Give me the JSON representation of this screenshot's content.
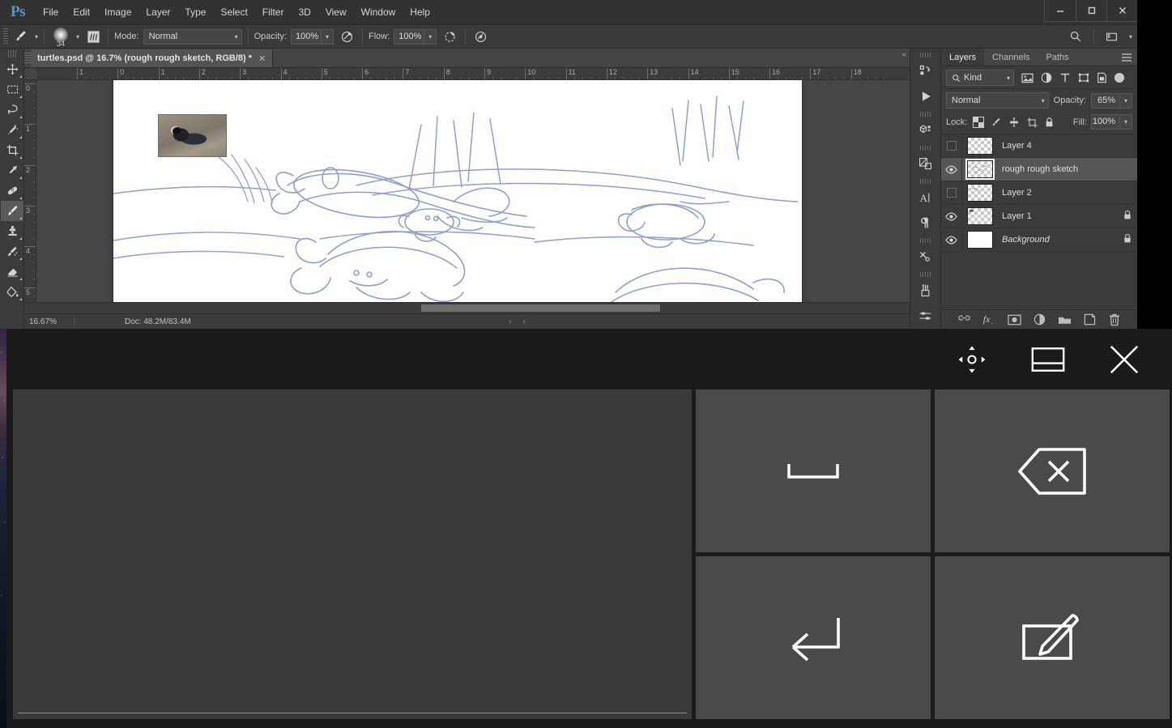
{
  "app": {
    "logo": "Ps",
    "menu": [
      "File",
      "Edit",
      "Image",
      "Layer",
      "Type",
      "Select",
      "Filter",
      "3D",
      "View",
      "Window",
      "Help"
    ],
    "window_controls": {
      "minimize": "—",
      "maximize": "□",
      "close": "✕"
    }
  },
  "options_bar": {
    "brush_size": "34",
    "mode_label": "Mode:",
    "mode_value": "Normal",
    "opacity_label": "Opacity:",
    "opacity_value": "100%",
    "flow_label": "Flow:",
    "flow_value": "100%"
  },
  "tools": [
    {
      "name": "move-tool",
      "glyph": "move"
    },
    {
      "name": "rectangular-marquee-tool",
      "glyph": "marquee"
    },
    {
      "name": "lasso-tool",
      "glyph": "lasso"
    },
    {
      "name": "quick-selection-tool",
      "glyph": "wand"
    },
    {
      "name": "crop-tool",
      "glyph": "crop"
    },
    {
      "name": "eyedropper-tool",
      "glyph": "eyedropper"
    },
    {
      "name": "healing-brush-tool",
      "glyph": "healing"
    },
    {
      "name": "brush-tool",
      "glyph": "brush",
      "active": true
    },
    {
      "name": "clone-stamp-tool",
      "glyph": "stamp"
    },
    {
      "name": "history-brush-tool",
      "glyph": "historybrush"
    },
    {
      "name": "eraser-tool",
      "glyph": "eraser"
    },
    {
      "name": "paint-bucket-tool",
      "glyph": "bucket"
    }
  ],
  "document": {
    "tab_title": "turtles.psd @ 16.7% (rough rough sketch, RGB/8) *",
    "tab_close": "✕",
    "ruler_h_labels": [
      "1",
      "0",
      "1",
      "2",
      "3",
      "4",
      "5",
      "6",
      "7",
      "8",
      "9",
      "10",
      "11",
      "12",
      "13",
      "14",
      "15",
      "16",
      "17",
      "18"
    ],
    "ruler_v_labels": [
      "0",
      "1",
      "2",
      "3",
      "4",
      "5"
    ]
  },
  "status_bar": {
    "zoom": "16.67%",
    "doc_info": "Doc: 48.2M/83.4M",
    "next_arrow": "›",
    "prev_arrow": "‹"
  },
  "rail": [
    {
      "name": "history-panel-icon"
    },
    {
      "name": "actions-play-icon"
    },
    {
      "name": "3d-panel-icon"
    },
    {
      "name": "layer-comps-icon"
    },
    {
      "name": "character-panel-icon",
      "text": "A"
    },
    {
      "name": "paragraph-panel-icon",
      "text": "¶"
    },
    {
      "name": "tool-presets-icon"
    },
    {
      "name": "brush-presets-icon"
    },
    {
      "name": "brush-settings-icon"
    }
  ],
  "layers_panel": {
    "tabs": [
      "Layers",
      "Channels",
      "Paths"
    ],
    "active_tab": "Layers",
    "filter": {
      "kind_label": "Kind",
      "icons": [
        "pixel-filter-icon",
        "adjustment-filter-icon",
        "type-filter-icon",
        "shape-filter-icon",
        "smart-object-filter-icon"
      ]
    },
    "blend_mode": "Normal",
    "opacity_label": "Opacity:",
    "opacity_value": "65%",
    "lock_label": "Lock:",
    "fill_label": "Fill:",
    "fill_value": "100%",
    "lock_icons": [
      "lock-transparent-pixels-icon",
      "lock-image-pixels-icon",
      "lock-position-icon",
      "lock-artboard-nesting-icon",
      "lock-all-icon"
    ],
    "layers": [
      {
        "name": "Layer 4",
        "visible": false,
        "locked": false,
        "selected": false,
        "italic": false,
        "transparent": true
      },
      {
        "name": "rough rough sketch",
        "visible": true,
        "locked": false,
        "selected": true,
        "italic": false,
        "transparent": true
      },
      {
        "name": "Layer 2",
        "visible": false,
        "locked": false,
        "selected": false,
        "italic": false,
        "transparent": true
      },
      {
        "name": "Layer 1",
        "visible": true,
        "locked": true,
        "selected": false,
        "italic": false,
        "transparent": true
      },
      {
        "name": "Background",
        "visible": true,
        "locked": true,
        "selected": false,
        "italic": true,
        "transparent": false
      }
    ],
    "footer_icons": [
      "link-layers-icon",
      "layer-style-fx-icon",
      "add-layer-mask-icon",
      "new-adjustment-layer-icon",
      "new-group-icon",
      "new-layer-icon",
      "delete-layer-icon"
    ]
  },
  "input_overlay": {
    "toolbar_buttons": [
      {
        "name": "move-panel-icon"
      },
      {
        "name": "split-layout-icon"
      },
      {
        "name": "close-panel-icon"
      }
    ],
    "writing_area": {
      "name": "handwriting-input-area",
      "value": "",
      "placeholder": ""
    },
    "keys": [
      {
        "name": "space-key",
        "glyph": "space"
      },
      {
        "name": "backspace-key",
        "glyph": "backspace"
      },
      {
        "name": "enter-key",
        "glyph": "enter"
      },
      {
        "name": "handwriting-mode-key",
        "glyph": "write"
      }
    ]
  },
  "colors": {
    "accent": "#4a9cd6",
    "panel_bg": "#3b3b3b",
    "options_bg": "#393939",
    "canvas_bg": "#464646",
    "overlay_bg": "#1b1b1b",
    "key_bg": "#4a4a4a",
    "sketch_blue": "#8ba0cc"
  }
}
